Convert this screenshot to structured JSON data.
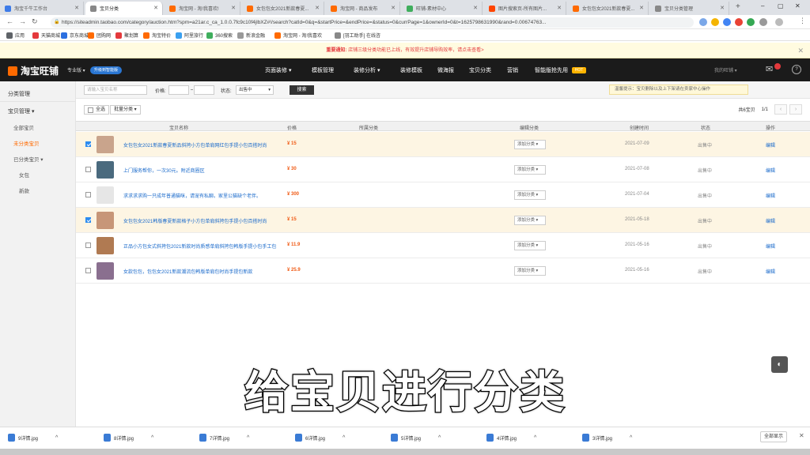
{
  "browser": {
    "tabs": [
      {
        "label": "淘宝千牛工作台",
        "color": "#3d7be8",
        "active": false
      },
      {
        "label": "宝贝分类",
        "color": "#888888",
        "active": true
      },
      {
        "label": "淘宝网 - 淘!我喜欢!",
        "color": "#ff6a00",
        "active": false
      },
      {
        "label": "女包包女2021新款春夏...",
        "color": "#ff6a00",
        "active": false
      },
      {
        "label": "淘宝网 - 商品发布",
        "color": "#ff6a00",
        "active": false
      },
      {
        "label": "旺铺-素材中心",
        "color": "#3fae5d",
        "active": false
      },
      {
        "label": "图片搜索页-所有图片...",
        "color": "#ff4400",
        "active": false
      },
      {
        "label": "女包包女2021新款春夏...",
        "color": "#ff6a00",
        "active": false
      },
      {
        "label": "宝贝分类管理",
        "color": "#888888",
        "active": false
      }
    ],
    "url": "https://siteadmin.taobao.com/category/auction.htm?spm=a21ar.c_ca_1.0.0.7fc9c10f4jlbXZ#!/search?catId=0&q=&startPrice=&endPrice=&status=0&currPage=1&ownerId=0&t=1625798631990&rand=0.00674763...",
    "bookmarks": [
      {
        "label": "应用",
        "color": "#5f6368"
      },
      {
        "label": "天猫商城",
        "color": "#e4393c"
      },
      {
        "label": "京东商城",
        "color": "#2b6fe0"
      },
      {
        "label": "团购网",
        "color": "#ff6a00"
      },
      {
        "label": "聚划算",
        "color": "#e4393c"
      },
      {
        "label": "淘宝特价",
        "color": "#ff6a00"
      },
      {
        "label": "阿里旅行",
        "color": "#3aa0f0"
      },
      {
        "label": "360搜索",
        "color": "#3fae5d"
      },
      {
        "label": "新浪金融",
        "color": "#999999"
      },
      {
        "label": "淘宝网 - 淘!我喜欢",
        "color": "#ff6a00"
      },
      {
        "label": "[羽工助手] 在线咨",
        "color": "#888888"
      }
    ]
  },
  "notice": {
    "prefix": "重要通知:",
    "text": "店铺三级分类功能已上线，有效提升店铺导购效率，请点击查看>"
  },
  "header": {
    "logo": "淘宝旺铺",
    "edition": "专业版 ▾",
    "upgrade": "升级到智能版",
    "nav": [
      "页面装修 ▾",
      "模板管理",
      "装修分析 ▾",
      "装修模板",
      "微海报",
      "宝贝分类",
      "营销",
      "智能版抢先用"
    ],
    "hot_tag": "HOT",
    "right_label": "我的旺铺 ▾"
  },
  "sidebar": {
    "items": [
      {
        "label": "分类管理",
        "level": 0,
        "active": false
      },
      {
        "label": "宝贝管理 ▾",
        "level": 0,
        "active": false
      },
      {
        "label": "全部宝贝",
        "level": 1,
        "active": false
      },
      {
        "label": "未分类宝贝",
        "level": 1,
        "active": true
      },
      {
        "label": "已分类宝贝 ▾",
        "level": 1,
        "active": false
      },
      {
        "label": "女包",
        "level": 2,
        "active": false
      },
      {
        "label": "新款",
        "level": 2,
        "active": false
      }
    ]
  },
  "filter": {
    "name_placeholder": "请输入宝贝名称",
    "price_label": "价格:",
    "status_label": "状态:",
    "status_value": "出售中",
    "search_button": "搜索",
    "tip": "温馨提示：宝贝删除以及上下架请在卖家中心操作"
  },
  "toolbar": {
    "select_all": "全选",
    "batch_category": "批量分类 ▾",
    "total": "共6宝贝",
    "page": "1/1"
  },
  "table": {
    "headers": [
      "宝贝名称",
      "价格",
      "所属分类",
      "编辑分类",
      "创建时间",
      "状态",
      "操作"
    ],
    "rows": [
      {
        "title": "女包包女2021新款春夏新品斜挎小方包单肩网红包手提小包百搭时尚",
        "price": "¥ 15",
        "category": "添加分类 ▾",
        "date": "2021-07-09",
        "status": "出售中",
        "op": "编辑",
        "checked": true,
        "thumb": "#c9a48c"
      },
      {
        "title": "上门服务帮你，一次30元。附近商圈区",
        "price": "¥ 30",
        "category": "添加分类 ▾",
        "date": "2021-07-08",
        "status": "出售中",
        "op": "编辑",
        "checked": false,
        "thumb": "#4a6a7e"
      },
      {
        "title": "求求求求购一只成年普通猫咪，请宠有私聊。家里公猫缺个老伴。",
        "price": "¥ 300",
        "category": "添加分类 ▾",
        "date": "2021-07-04",
        "status": "出售中",
        "op": "编辑",
        "checked": false,
        "thumb": "#e6e6e6"
      },
      {
        "title": "女包包女2021韩版春夏新款格子小方包单肩斜挎包手提小包百搭时尚",
        "price": "¥ 15",
        "category": "添加分类 ▾",
        "date": "2021-05-18",
        "status": "出售中",
        "op": "编辑",
        "checked": true,
        "thumb": "#c79678"
      },
      {
        "title": "正品小方包女式斜挎包2021新款时尚质感单肩斜挎包韩版手提小包手工包",
        "price": "¥ 11.9",
        "category": "添加分类 ▾",
        "date": "2021-05-16",
        "status": "出售中",
        "op": "编辑",
        "checked": false,
        "thumb": "#b07a52"
      },
      {
        "title": "女款包包，包包女2021新款潮流包韩版单肩包时尚手提包新款",
        "price": "¥ 25.9",
        "category": "添加分类 ▾",
        "date": "2021-05-16",
        "status": "出售中",
        "op": "编辑",
        "checked": false,
        "thumb": "#8a6f8f"
      }
    ]
  },
  "subtitle": "给宝贝进行分类",
  "downloads": {
    "files": [
      "9详情.jpg",
      "8详情.jpg",
      "7详情.jpg",
      "6详情.jpg",
      "5详情.jpg",
      "4详情.jpg",
      "3详情.jpg"
    ],
    "show_all": "全部显示"
  }
}
